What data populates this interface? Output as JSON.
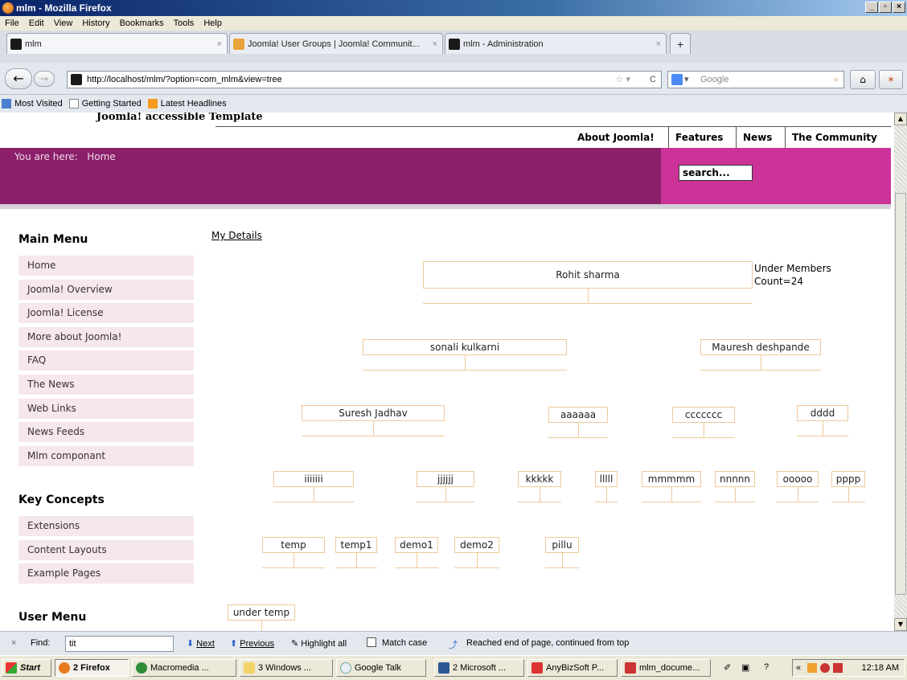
{
  "window": {
    "title": "mlm - Mozilla Firefox"
  },
  "menu": [
    "File",
    "Edit",
    "View",
    "History",
    "Bookmarks",
    "Tools",
    "Help"
  ],
  "tabs": [
    {
      "label": "mlm"
    },
    {
      "label": "Joomla! User Groups | Joomla! Communit..."
    },
    {
      "label": "mlm - Administration"
    }
  ],
  "nav": {
    "url": "http://localhost/mlm/?option=com_mlm&view=tree",
    "search_placeholder": "Google"
  },
  "bookmarks": [
    "Most Visited",
    "Getting Started",
    "Latest Headlines"
  ],
  "page": {
    "template_name": "Joomla! accessible Template",
    "topnav": [
      "About Joomla!",
      "Features",
      "News",
      "The Community"
    ],
    "breadcrumb_prefix": "You are here:",
    "breadcrumb_home": "Home",
    "search_value": "search...",
    "main_menu_title": "Main Menu",
    "main_menu": [
      "Home",
      "Joomla! Overview",
      "Joomla! License",
      "More about Joomla!",
      "FAQ",
      "The News",
      "Web Links",
      "News Feeds",
      "Mlm componant"
    ],
    "key_concepts_title": "Key Concepts",
    "key_concepts": [
      "Extensions",
      "Content Layouts",
      "Example Pages"
    ],
    "user_menu_title": "User Menu",
    "my_details": "My Details",
    "under_members": "Under Members",
    "count": "Count=24"
  },
  "tree": {
    "root": "Rohit sharma",
    "level1": [
      "sonali kulkarni",
      "Mauresh deshpande"
    ],
    "level2": [
      "Suresh Jadhav",
      "aaaaaa",
      "ccccccc",
      "dddd"
    ],
    "level3": [
      "iiiiiii",
      "jjjjjj",
      "kkkkk",
      "lllll",
      "mmmmm",
      "nnnnn",
      "ooooo",
      "pppp"
    ],
    "level4": [
      "temp",
      "temp1",
      "demo1",
      "demo2",
      "pillu"
    ],
    "level5": [
      "under temp"
    ]
  },
  "findbar": {
    "label": "Find:",
    "value": "tit",
    "next": "Next",
    "previous": "Previous",
    "highlight": "Highlight all",
    "match_case": "Match case",
    "status": "Reached end of page, continued from top"
  },
  "taskbar": {
    "start": "Start",
    "items": [
      "2 Firefox",
      "Macromedia ...",
      "3 Windows ...",
      "Google Talk",
      "2 Microsoft ...",
      "AnyBizSoft P...",
      "mlm_docume..."
    ],
    "clock": "12:18 AM"
  }
}
